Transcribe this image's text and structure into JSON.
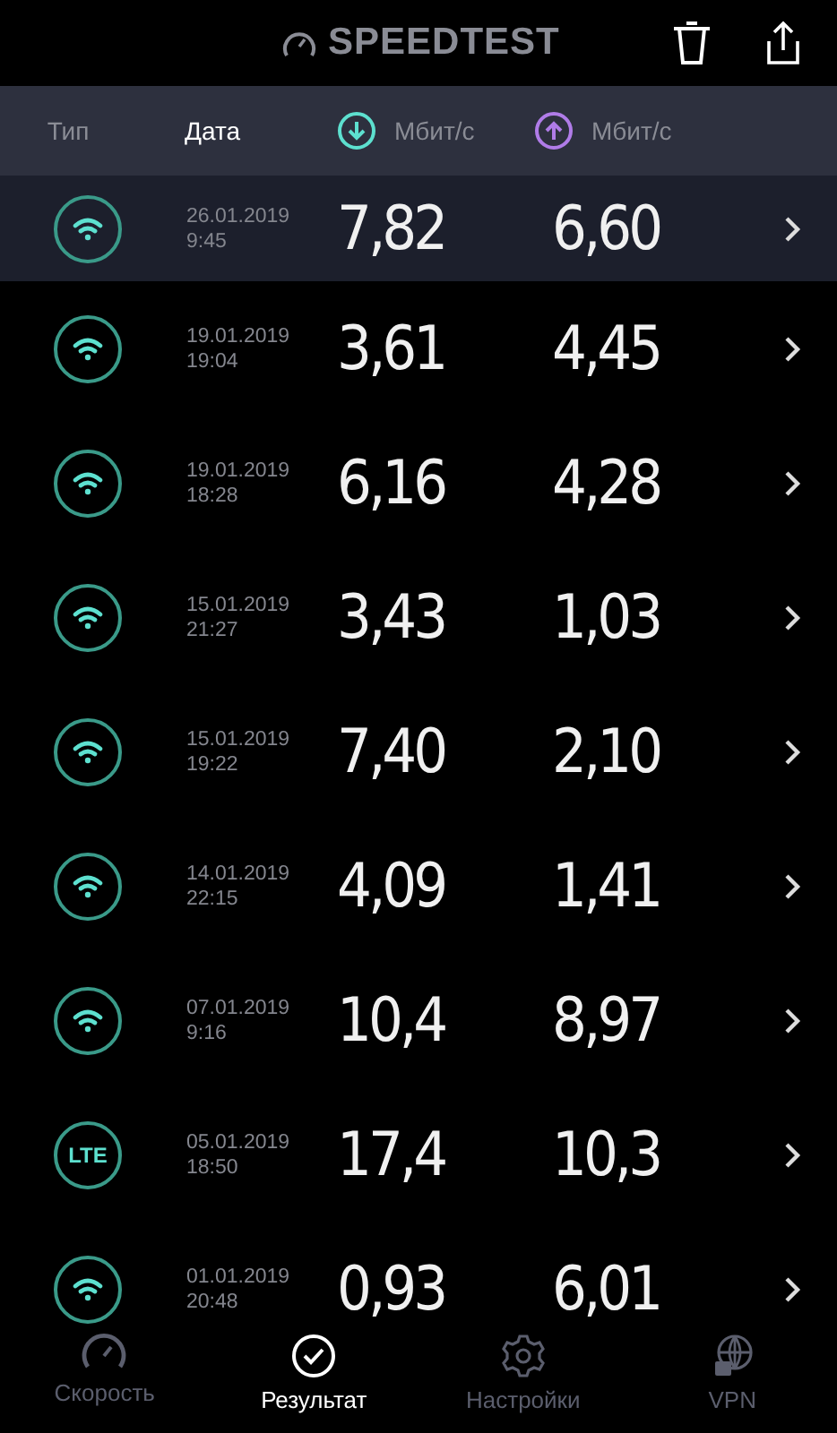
{
  "header": {
    "logo": "SPEEDTEST"
  },
  "columns": {
    "type": "Тип",
    "date": "Дата",
    "download": "Мбит/с",
    "upload": "Мбит/с"
  },
  "results": [
    {
      "kind": "wifi",
      "date": "26.01.2019",
      "time": "9:45",
      "download": "7,82",
      "upload": "6,60",
      "selected": true
    },
    {
      "kind": "wifi",
      "date": "19.01.2019",
      "time": "19:04",
      "download": "3,61",
      "upload": "4,45",
      "selected": false
    },
    {
      "kind": "wifi",
      "date": "19.01.2019",
      "time": "18:28",
      "download": "6,16",
      "upload": "4,28",
      "selected": false
    },
    {
      "kind": "wifi",
      "date": "15.01.2019",
      "time": "21:27",
      "download": "3,43",
      "upload": "1,03",
      "selected": false
    },
    {
      "kind": "wifi",
      "date": "15.01.2019",
      "time": "19:22",
      "download": "7,40",
      "upload": "2,10",
      "selected": false
    },
    {
      "kind": "wifi",
      "date": "14.01.2019",
      "time": "22:15",
      "download": "4,09",
      "upload": "1,41",
      "selected": false
    },
    {
      "kind": "wifi",
      "date": "07.01.2019",
      "time": "9:16",
      "download": "10,4",
      "upload": "8,97",
      "selected": false
    },
    {
      "kind": "lte",
      "label": "LTE",
      "date": "05.01.2019",
      "time": "18:50",
      "download": "17,4",
      "upload": "10,3",
      "selected": false
    },
    {
      "kind": "wifi",
      "date": "01.01.2019",
      "time": "20:48",
      "download": "0,93",
      "upload": "6,01",
      "selected": false
    }
  ],
  "tabs": [
    {
      "kind": "speed",
      "label": "Скорость",
      "selected": false
    },
    {
      "kind": "results",
      "label": "Результат",
      "selected": true
    },
    {
      "kind": "settings",
      "label": "Настройки",
      "selected": false
    },
    {
      "kind": "vpn",
      "label": "VPN",
      "selected": false
    }
  ]
}
